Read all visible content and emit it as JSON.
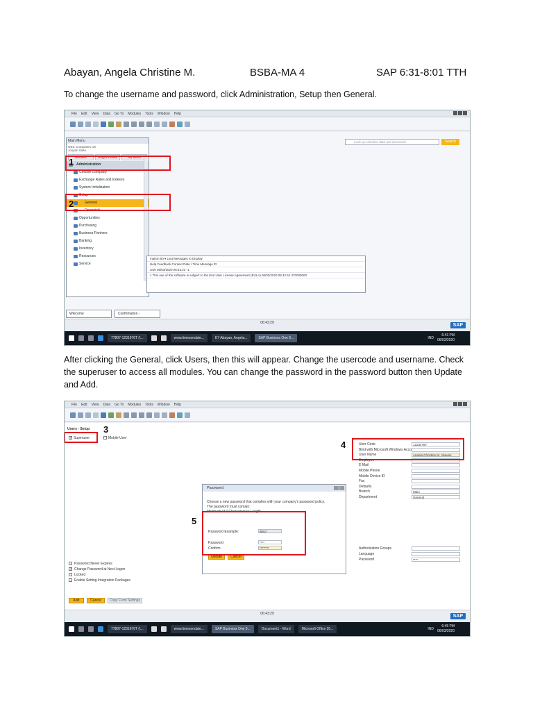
{
  "header": {
    "name": "Abayan, Angela Christine M.",
    "program": "BSBA-MA 4",
    "course": "SAP 6:31-8:01 TTH"
  },
  "intro_text": "To change the username and password, click Administration, Setup then General.",
  "middle_text": "After clicking the General, click Users, then this will appear. Change the usercode and username. Check the superuser to access all modules. You can change the password in the password button then Update and Add.",
  "menubar": [
    "File",
    "Edit",
    "View",
    "Data",
    "Go To",
    "Modules",
    "Tools",
    "Window",
    "Help"
  ],
  "shot1": {
    "main_menu_title": "Main Menu",
    "company": [
      "OEC Computers UK",
      "Jouyan Suite"
    ],
    "tabs": [
      "Modules",
      "Drag & Relate",
      "My Menu"
    ],
    "items": [
      {
        "label": "Administration",
        "kind": "head"
      },
      {
        "label": "Choose Company",
        "kind": "item"
      },
      {
        "label": "Exchange Rates and Indexes",
        "kind": "item"
      },
      {
        "label": "System Initialization",
        "kind": "item"
      },
      {
        "label": "Setup",
        "kind": "item"
      },
      {
        "label": "General",
        "kind": "hl"
      },
      {
        "label": "Financials",
        "kind": "item"
      },
      {
        "label": "Opportunities",
        "kind": "item"
      },
      {
        "label": "Purchasing",
        "kind": "item"
      },
      {
        "label": "Business Partners",
        "kind": "item"
      },
      {
        "label": "Banking",
        "kind": "item"
      },
      {
        "label": "Inventory",
        "kind": "item"
      },
      {
        "label": "Resources",
        "kind": "item"
      },
      {
        "label": "Service",
        "kind": "item"
      }
    ],
    "search_placeholder": "Look up selection data and document",
    "search_button": "Search",
    "messages": {
      "row1": "mation     50 ▾  Last Messages to Display",
      "row2": "Help   Feedback   Context        Date / Time       Message ID",
      "row3": "ords                                       06/03/2020  06:43:23   -1",
      "row4": "1   This use of the software is subject to the End User License Agreement (EULA)    06/03/2020  06:42:44   470000000"
    },
    "bottom_tabs": [
      "Welcome",
      "Confirmation -"
    ],
    "status_time": [
      "06:43:29",
      "                               "
    ],
    "status_code": "SAP",
    "taskbar": [
      "77807-1231676T (\\...",
      "www.timesondate...",
      "E7 Abayan, Angela...",
      "SAP Business One 9..."
    ],
    "clock": [
      "6:43 PM",
      "06/03/2020"
    ],
    "ind": "IND"
  },
  "shot2": {
    "form_title": "Users - Setup",
    "superuser": "Superuser",
    "mobile_user": "Mobile User",
    "fields": [
      {
        "label": "User Code",
        "value": "12234767"
      },
      {
        "label": "Bind with Microsoft Windows Account",
        "value": ""
      },
      {
        "label": "User Name",
        "value": "Angela Christine M. Abayan"
      },
      {
        "label": "Employee",
        "value": ""
      },
      {
        "label": "E-Mail",
        "value": ""
      },
      {
        "label": "Mobile Phone",
        "value": ""
      },
      {
        "label": "Mobile Device ID",
        "value": ""
      },
      {
        "label": "Fax",
        "value": ""
      },
      {
        "label": "Defaults",
        "value": ""
      },
      {
        "label": "Branch",
        "value": "Main"
      },
      {
        "label": "Department",
        "value": "General"
      }
    ],
    "lower_fields": [
      {
        "label": "Authorization Groups",
        "value": ""
      },
      {
        "label": "Language",
        "value": ""
      },
      {
        "label": "Password",
        "value": "****"
      }
    ],
    "options": [
      {
        "label": "Password Never Expires",
        "checked": false
      },
      {
        "label": "Change Password at Next Logon",
        "checked": true
      },
      {
        "label": "Locked",
        "checked": false
      },
      {
        "label": "Enable Setting Integration Packages",
        "checked": false
      }
    ],
    "buttons": {
      "add": "Add",
      "cancel": "Cancel",
      "copy": "Copy Form Settings"
    },
    "password_dialog": {
      "title": "Password",
      "text": [
        "Choose a new password that complies with your company's password policy.",
        "The password must contain:",
        "Minimum of 4 Characters in Length."
      ],
      "example_label": "Password Example:",
      "example_value": "abcd",
      "password_label": "Password",
      "password_value": "****",
      "confirm_label": "Confirm",
      "confirm_value": "********",
      "update": "Update",
      "cancel": "Cancel"
    },
    "status_time": [
      "06:43:29",
      "                        "
    ],
    "taskbar": [
      "77807-1231676T (\\...",
      "www.timesondate...",
      "SAP Business One 9...",
      "Document1 - Word",
      "Microsoft Office 20..."
    ],
    "clock": [
      "6:45 PM",
      "06/03/2020"
    ],
    "ind": "IND"
  },
  "annotations": [
    "1",
    "2",
    "3",
    "4",
    "5"
  ]
}
